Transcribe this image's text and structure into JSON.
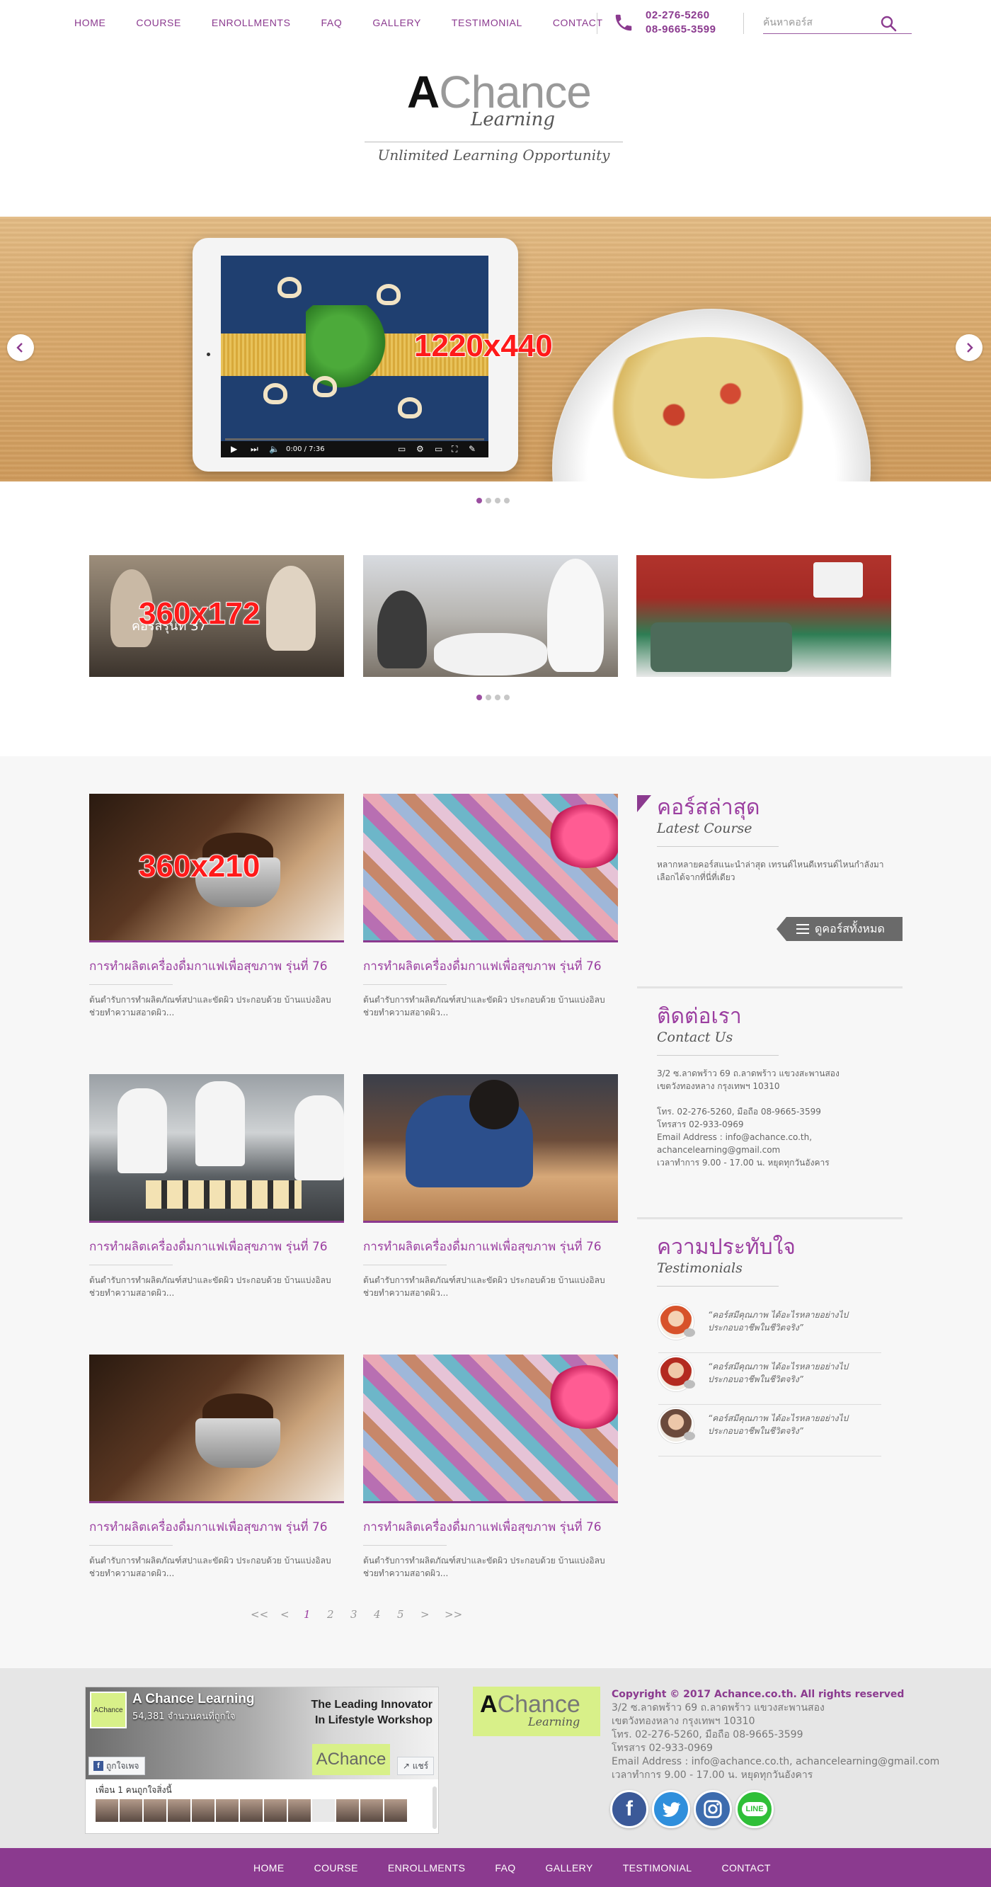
{
  "nav": [
    "HOME",
    "COURSE",
    "ENROLLMENTS",
    "FAQ",
    "GALLERY",
    "TESTIMONIAL",
    "CONTACT"
  ],
  "header": {
    "phone1": "02-276-5260",
    "phone2": "08-9665-3599",
    "search_placeholder": "ค้นหาคอร์ส"
  },
  "logo": {
    "a": "A",
    "chance": "Chance",
    "learning": "Learning",
    "tagline": "Unlimited Learning Opportunity"
  },
  "hero": {
    "placeholder": "1220x440",
    "video_time": "0:00 / 7:36",
    "slides": 4,
    "active_slide": 1
  },
  "promos": {
    "placeholder": "360x172",
    "caption": "คอร์สรุ่นที่ 37",
    "slides": 4,
    "active_slide": 1
  },
  "cards": [
    {
      "title": "การทำผลิตเครื่องดื่มกาแฟเพื่อสุขภาพ รุ่นที่ 76",
      "desc": "ต้นตำรับการทำผลิตภัณฑ์สปาและขัดผิว ประกอบด้วย บ้านแบ่งอิลบช่วยทำความสอาดผิว...",
      "image": "coffee",
      "placeholder": "360x210"
    },
    {
      "title": "การทำผลิตเครื่องดื่มกาแฟเพื่อสุขภาพ รุ่นที่ 76",
      "desc": "ต้นตำรับการทำผลิตภัณฑ์สปาและขัดผิว ประกอบด้วย บ้านแบ่งอิลบช่วยทำความสอาดผิว...",
      "image": "makeup"
    },
    {
      "title": "การทำผลิตเครื่องดื่มกาแฟเพื่อสุขภาพ รุ่นที่ 76",
      "desc": "ต้นตำรับการทำผลิตภัณฑ์สปาและขัดผิว ประกอบด้วย บ้านแบ่งอิลบช่วยทำความสอาดผิว...",
      "image": "bakers"
    },
    {
      "title": "การทำผลิตเครื่องดื่มกาแฟเพื่อสุขภาพ รุ่นที่ 76",
      "desc": "ต้นตำรับการทำผลิตภัณฑ์สปาและขัดผิว ประกอบด้วย บ้านแบ่งอิลบช่วยทำความสอาดผิว...",
      "image": "woodwork"
    },
    {
      "title": "การทำผลิตเครื่องดื่มกาแฟเพื่อสุขภาพ รุ่นที่ 76",
      "desc": "ต้นตำรับการทำผลิตภัณฑ์สปาและขัดผิว ประกอบด้วย บ้านแบ่งอิลบช่วยทำความสอาดผิว...",
      "image": "coffee"
    },
    {
      "title": "การทำผลิตเครื่องดื่มกาแฟเพื่อสุขภาพ รุ่นที่ 76",
      "desc": "ต้นตำรับการทำผลิตภัณฑ์สปาและขัดผิว ประกอบด้วย บ้านแบ่งอิลบช่วยทำความสอาดผิว...",
      "image": "makeup"
    }
  ],
  "sidebar": {
    "latest": {
      "title_th": "คอร์สล่าสุด",
      "title_en": "Latest Course",
      "text1": "หลากหลายคอร์สแนะนำล่าสุด เทรนด์ไหนดีเทรนด์ไหนกำลังมา",
      "text2": "เลือกได้จากที่นี่ที่เดียว",
      "button": "ดูคอร์สทั้งหมด"
    },
    "contact": {
      "title_th": "ติดต่อเรา",
      "title_en": "Contact Us",
      "addr1": "3/2 ซ.ลาดพร้าว 69 ถ.ลาดพร้าว แขวงสะพานสอง",
      "addr2": "เขตวังทองหลาง กรุงเทพฯ 10310",
      "tel": "โทร. 02-276-5260, มือถือ 08-9665-3599",
      "fax": "โทรสาร 02-933-0969",
      "email1": "Email Address : info@achance.co.th,",
      "email2": "achancelearning@gmail.com",
      "hours": "เวลาทำการ 9.00 - 17.00 น. หยุดทุกวันอังคาร"
    },
    "testimonials": {
      "title_th": "ความประทับใจ",
      "title_en": "Testimonials",
      "items": [
        {
          "line1": "“คอร์สมีคุณภาพ ได้อะไรหลายอย่างไป",
          "line2": "ประกอบอาชีพในชีวิตจริง”"
        },
        {
          "line1": "“คอร์สมีคุณภาพ ได้อะไรหลายอย่างไป",
          "line2": "ประกอบอาชีพในชีวิตจริง”"
        },
        {
          "line1": "“คอร์สมีคุณภาพ ได้อะไรหลายอย่างไป",
          "line2": "ประกอบอาชีพในชีวิตจริง”"
        }
      ]
    }
  },
  "pagination": [
    "<<",
    "<",
    "1",
    "2",
    "3",
    "4",
    "5",
    ">",
    ">>"
  ],
  "pagination_current": "1",
  "footer": {
    "fb": {
      "logo": "AChance",
      "name": "A Chance Learning",
      "count": "54,381 จำนวนคนที่ถูกใจ",
      "tagline1": "The Leading Innovator",
      "tagline2": "In Lifestyle Workshop",
      "badge": "AChance",
      "like": "ถูกใจเพจ",
      "share": "แชร์",
      "friends": "เพื่อน 1 คนถูกใจสิ่งนี้"
    },
    "logo_a": "A",
    "logo_chance": "Chance",
    "logo_learning": "Learning",
    "copyright": "Copyright © 2017 Achance.co.th. All rights reserved",
    "addr1": "3/2 ซ.ลาดพร้าว 69 ถ.ลาดพร้าว แขวงสะพานสอง",
    "addr2": "เขตวังทองหลาง กรุงเทพฯ 10310",
    "tel": "โทร. 02-276-5260, มือถือ 08-9665-3599",
    "fax": "โทรสาร 02-933-0969",
    "email": "Email Address : info@achance.co.th, achancelearning@gmail.com",
    "hours": "เวลาทำการ 9.00 - 17.00 น. หยุดทุกวันอังคาร",
    "social": [
      {
        "name": "facebook-icon",
        "color": "#3b5998",
        "glyph": "f"
      },
      {
        "name": "twitter-icon",
        "color": "#2f8fdc",
        "glyph": ""
      },
      {
        "name": "instagram-icon",
        "color": "#3d6cae",
        "glyph": ""
      },
      {
        "name": "line-icon",
        "color": "#2fbf38",
        "glyph": "LINE"
      }
    ]
  },
  "colors": {
    "accent": "#8b3a8f",
    "title_purple": "#9b3ea0",
    "footer_bg": "#e6e6e6",
    "main_bg": "#f7f7f7",
    "logo_green": "#d8f089"
  }
}
